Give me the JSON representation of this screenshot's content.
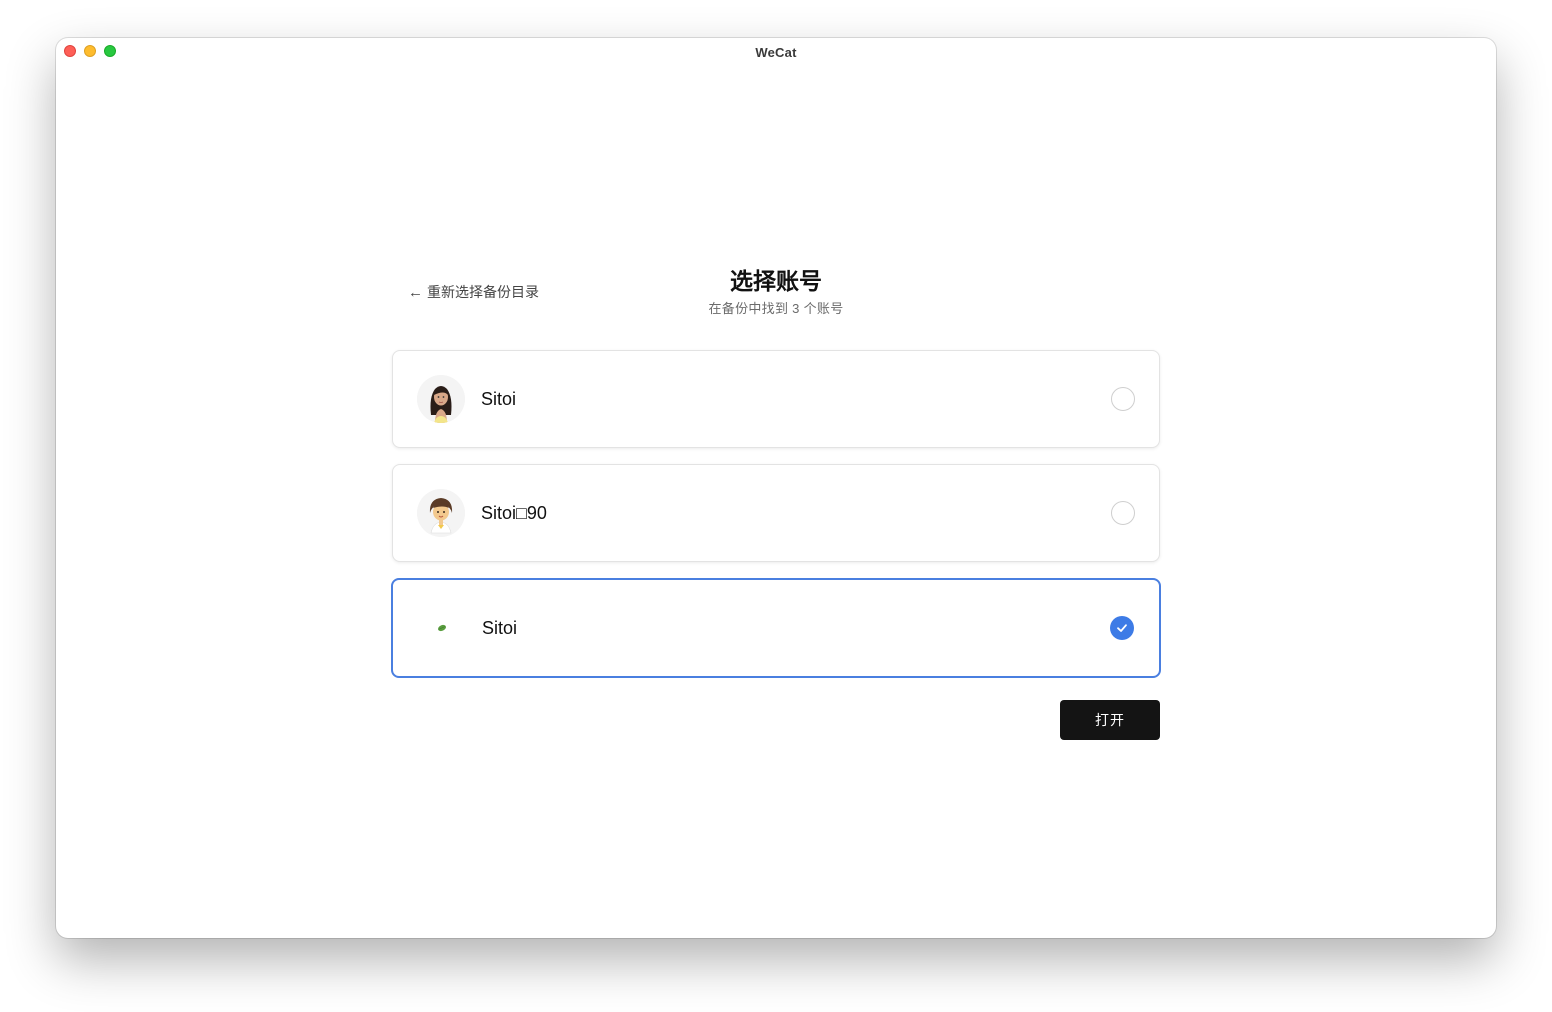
{
  "window": {
    "title": "WeCat"
  },
  "header": {
    "back_label": "重新选择备份目录",
    "back_arrow": "←",
    "title": "选择账号",
    "subtitle": "在备份中找到 3 个账号"
  },
  "accounts": [
    {
      "name": "Sitoi",
      "avatar_icon": "woman-long-hair-avatar-icon",
      "selected": false
    },
    {
      "name": "Sitoi□90",
      "avatar_icon": "girl-cartoon-avatar-icon",
      "selected": false
    },
    {
      "name": "Sitoi",
      "avatar_icon": "green-leaf-avatar-icon",
      "selected": true
    }
  ],
  "actions": {
    "open_label": "打开"
  },
  "colors": {
    "accent": "#3d7be6",
    "selected_border": "#4a7fe0",
    "button_bg": "#141414"
  }
}
